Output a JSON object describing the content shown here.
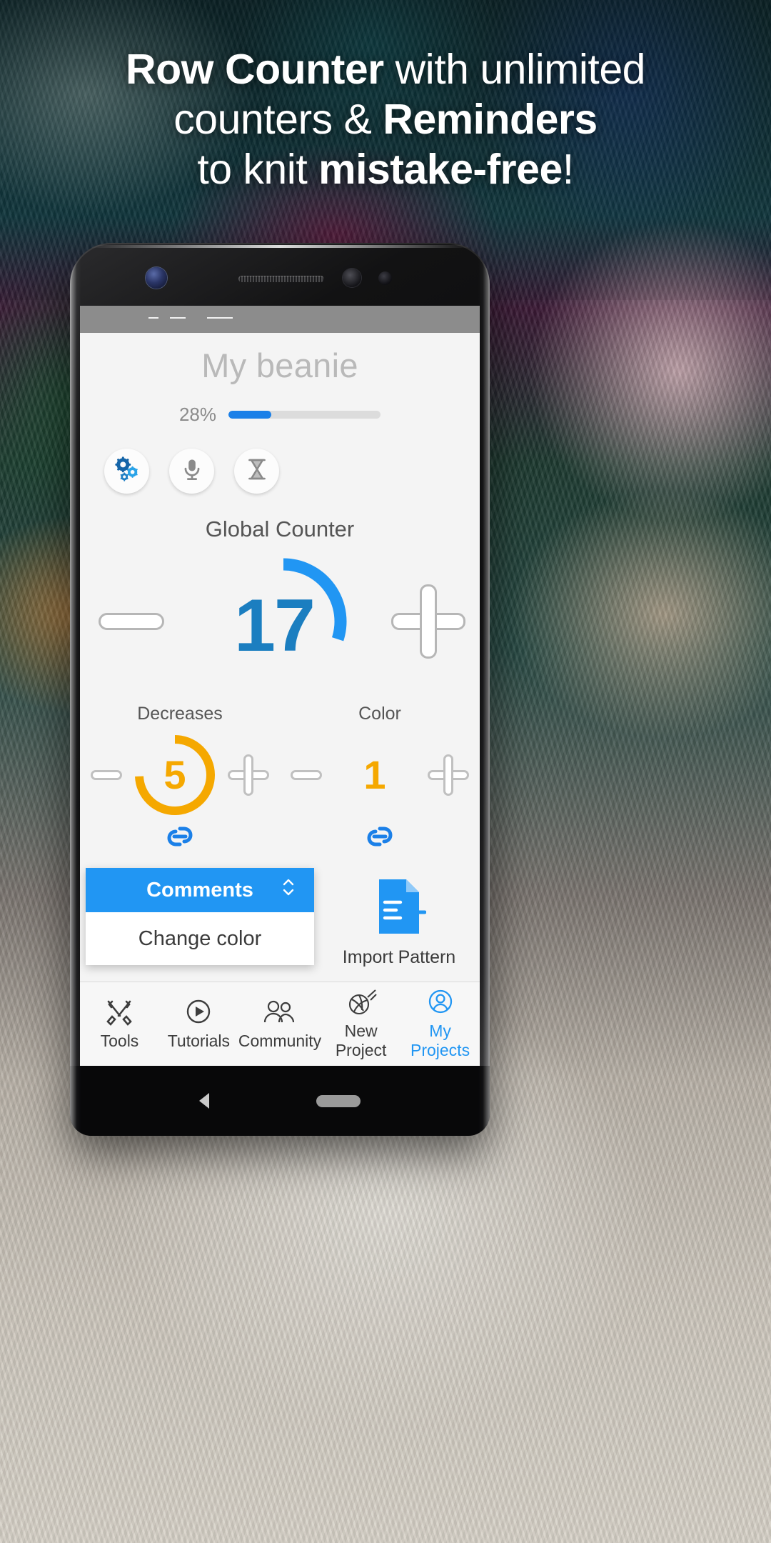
{
  "promo": {
    "line1_bold": "Row Counter",
    "line1_rest": " with unlimited",
    "line2_rest": "counters & ",
    "line2_bold": "Reminders",
    "line3_rest": "to knit ",
    "line3_bold": "mistake-free",
    "line3_tail": "!"
  },
  "app": {
    "project_title": "My beanie",
    "progress_percent": "28%",
    "progress_value": 28,
    "quick_actions": [
      {
        "name": "settings-gears-icon",
        "label": "Settings"
      },
      {
        "name": "microphone-icon",
        "label": "Voice control"
      },
      {
        "name": "hourglass-icon",
        "label": "Timer"
      }
    ],
    "global_counter": {
      "label": "Global Counter",
      "value": "17",
      "arc_percent": 28,
      "accent": "#2196f3",
      "value_color": "#1b7ec0",
      "decrement_label": "Decrease global counter",
      "increment_label": "Increase global counter"
    },
    "sub_counters": [
      {
        "label": "Decreases",
        "value": "5",
        "arc_percent": 72,
        "accent": "#f5a800",
        "link_label": "Link counter"
      },
      {
        "label": "Color",
        "value": "1",
        "arc_percent": 0,
        "accent": "#f5a800",
        "link_label": "Link counter"
      }
    ],
    "dropdown": {
      "header": "Comments",
      "selected": "Change color",
      "header_color": "#2196f3"
    },
    "import": {
      "label": "Import Pattern",
      "icon_color": "#2196f3"
    },
    "tabs": [
      {
        "label": "Tools",
        "icon": "tools-icon",
        "active": false
      },
      {
        "label": "Tutorials",
        "icon": "play-circle-icon",
        "active": false
      },
      {
        "label": "Community",
        "icon": "people-icon",
        "active": false
      },
      {
        "label": "New Project",
        "icon": "yarn-ball-icon",
        "active": false
      },
      {
        "label": "My Projects",
        "icon": "person-circle-icon",
        "active": true
      }
    ]
  }
}
